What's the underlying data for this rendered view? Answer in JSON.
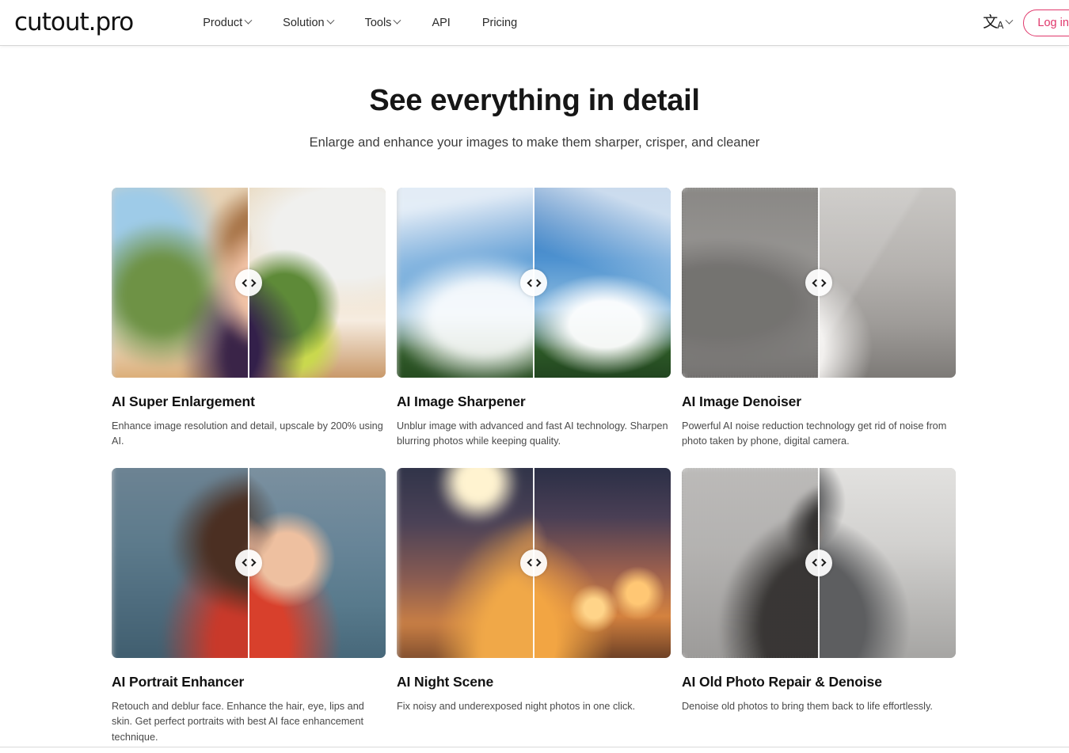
{
  "header": {
    "logo": "cutout.pro",
    "nav": [
      {
        "label": "Product",
        "has_caret": true
      },
      {
        "label": "Solution",
        "has_caret": true
      },
      {
        "label": "Tools",
        "has_caret": true
      },
      {
        "label": "API",
        "has_caret": false
      },
      {
        "label": "Pricing",
        "has_caret": false
      }
    ],
    "language": {
      "glyph": "文",
      "glyph_sub": "A",
      "has_caret": true
    },
    "login_label": "Log in /",
    "accent_color": "#e0376b"
  },
  "hero": {
    "title": "See everything in detail",
    "subtitle": "Enlarge and enhance your images to make them sharper, crisper, and cleaner"
  },
  "cards": [
    {
      "title": "AI Super Enlargement",
      "description": "Enhance image resolution and detail, upscale by 200% using AI.",
      "image_alt": "Young girl smiling at a table with potted plants, before and after enlargement",
      "divider_percent": 50,
      "handle_icon": "slider-compare-icon"
    },
    {
      "title": "AI Image Sharpener",
      "description": "Unblur image with advanced and fast AI technology. Sharpen blurring photos while keeping quality.",
      "image_alt": "Eiffel Tower against a blue cloudy sky, before and after sharpening",
      "divider_percent": 50,
      "handle_icon": "slider-compare-icon"
    },
    {
      "title": "AI Image Denoiser",
      "description": "Powerful AI noise reduction technology get rid of noise from photo taken by phone, digital camera.",
      "image_alt": "Black and white photo of a woman holding a transparent umbrella, before and after denoising",
      "divider_percent": 50,
      "handle_icon": "slider-compare-icon"
    },
    {
      "title": "AI Portrait Enhancer",
      "description": "Retouch and deblur face. Enhance the hair, eye, lips and skin. Get perfect portraits with best AI face enhancement technique.",
      "image_alt": "Woman in red polka dot dress by the water, before and after portrait enhancement",
      "divider_percent": 50,
      "handle_icon": "slider-compare-icon"
    },
    {
      "title": "AI Night Scene",
      "description": "Fix noisy and underexposed night photos in one click.",
      "image_alt": "Woman holding string lights at dusk over a city skyline, before and after night enhancement",
      "divider_percent": 50,
      "handle_icon": "slider-compare-icon"
    },
    {
      "title": "AI Old Photo Repair & Denoise",
      "description": "Denoise old photos to bring them back to life effortlessly.",
      "image_alt": "Elderly couple in hats and coats, before and after old photo repair",
      "divider_percent": 50,
      "handle_icon": "slider-compare-icon"
    }
  ]
}
